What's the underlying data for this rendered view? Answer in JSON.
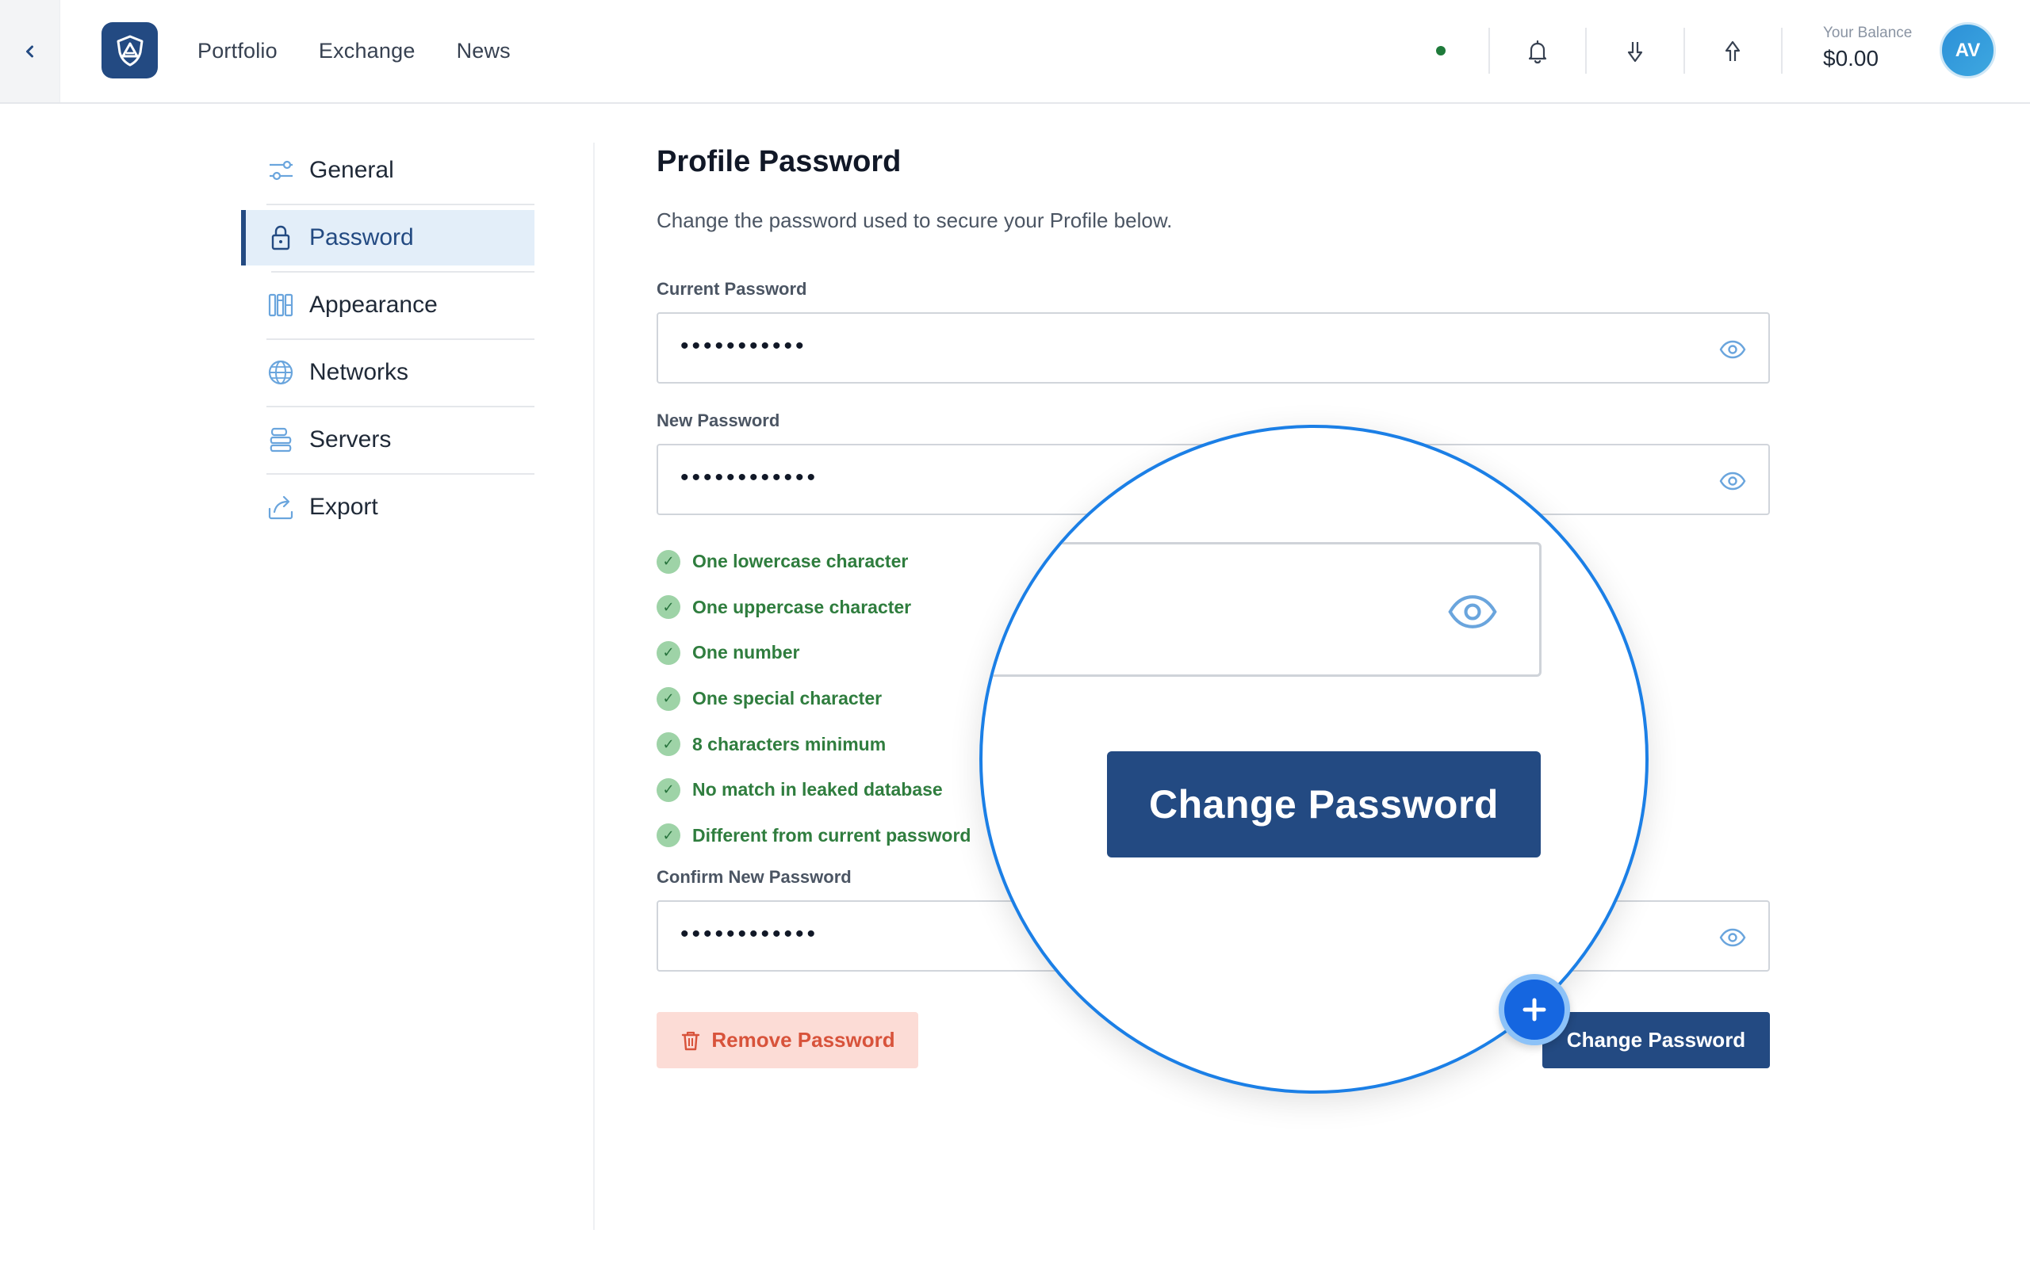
{
  "nav": {
    "items": [
      "Portfolio",
      "Exchange",
      "News"
    ]
  },
  "balance": {
    "label": "Your Balance",
    "value": "$0.00"
  },
  "user": {
    "initials": "AV"
  },
  "sidebar": {
    "items": [
      {
        "label": "General",
        "icon": "sliders-icon",
        "active": false
      },
      {
        "label": "Password",
        "icon": "lock-icon",
        "active": true
      },
      {
        "label": "Appearance",
        "icon": "appearance-icon",
        "active": false
      },
      {
        "label": "Networks",
        "icon": "globe-icon",
        "active": false
      },
      {
        "label": "Servers",
        "icon": "server-icon",
        "active": false
      },
      {
        "label": "Export",
        "icon": "export-icon",
        "active": false
      }
    ]
  },
  "main": {
    "title": "Profile Password",
    "description": "Change the password used to secure your Profile below.",
    "current_password": {
      "label": "Current Password",
      "value": "•••••••••••"
    },
    "new_password": {
      "label": "New Password",
      "value": "••••••••••••"
    },
    "requirements": [
      "One lowercase character",
      "One uppercase character",
      "One number",
      "One special character",
      "8 characters minimum",
      "No match in leaked database",
      "Different from current password"
    ],
    "confirm_password": {
      "label": "Confirm New Password",
      "value": "••••••••••••"
    },
    "remove_label": "Remove Password",
    "change_label": "Change Password"
  },
  "lens": {
    "button_label": "Change Password"
  },
  "colors": {
    "brand": "#234a82",
    "accent": "#1b7fe6",
    "success": "#2f7d3e",
    "danger": "#d8533b",
    "danger_bg": "#fcdcd6",
    "active_bg": "#e3eef9"
  }
}
